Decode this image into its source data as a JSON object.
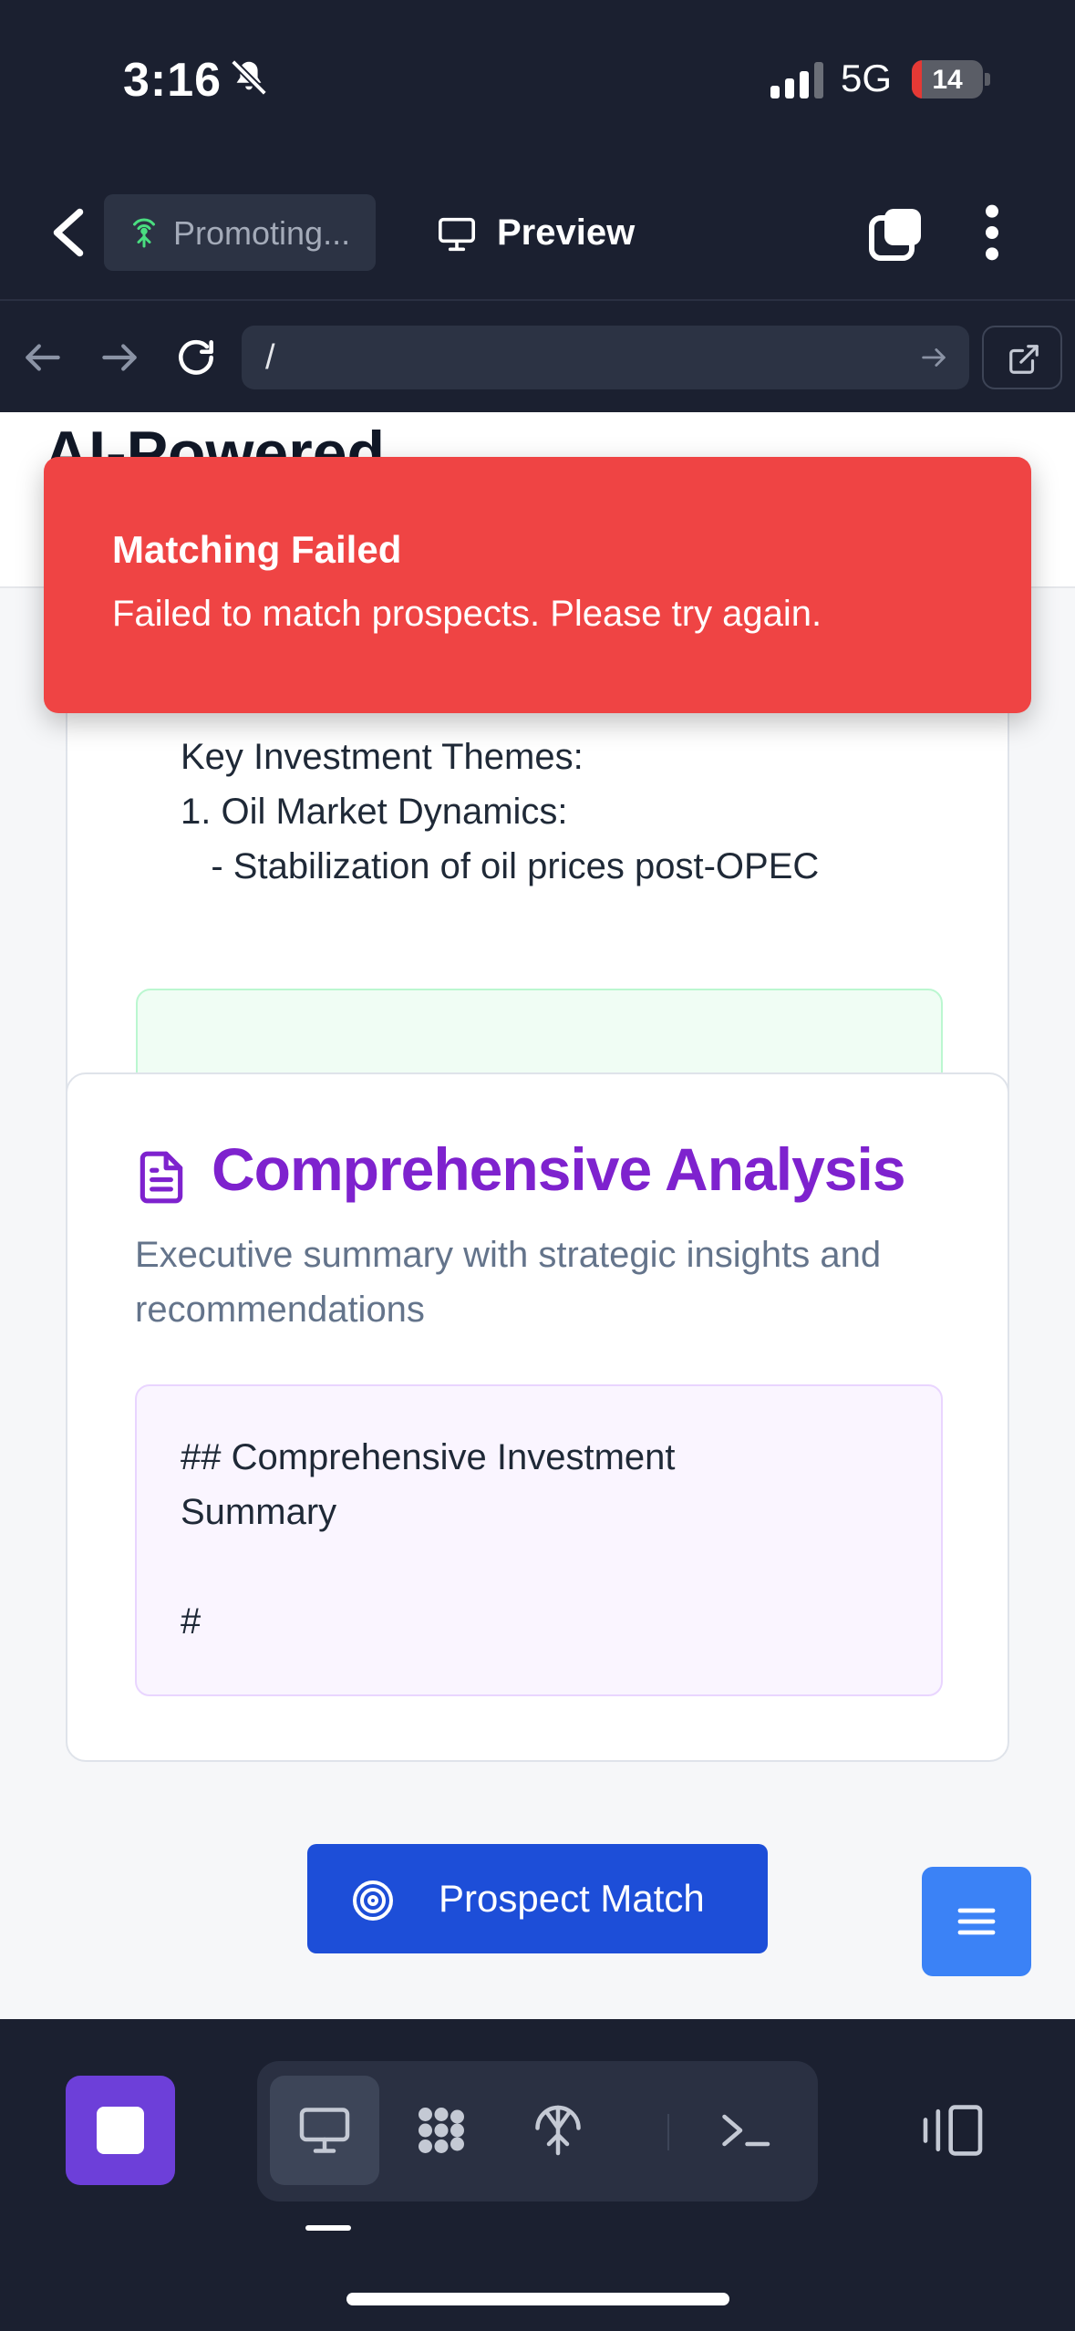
{
  "status_bar": {
    "time": "3:16",
    "network": "5G",
    "battery": "14",
    "battery_level": 0.14
  },
  "app_header": {
    "project_name": "Promoting...",
    "view_tab": "Preview"
  },
  "browser": {
    "url": "/"
  },
  "page": {
    "title": "AI-Powered",
    "card_top": {
      "themes_text": "Key Investment Themes:\n1. Oil Market Dynamics:\n   - Stabilization of oil prices post-OPEC"
    },
    "card_analysis": {
      "title": "Comprehensive Analysis",
      "subtitle": "Executive summary with strategic insights and recommendations",
      "summary_text": "## Comprehensive Investment\nSummary\n\n#"
    },
    "prospect_button": "Prospect Match"
  },
  "toast": {
    "title": "Matching Failed",
    "message": "Failed to match prospects. Please try again."
  },
  "colors": {
    "toast_bg": "#ef4444",
    "accent_purple": "#7e22ce",
    "primary_blue": "#1d4ed8",
    "stop_purple": "#6d3fd9"
  },
  "icons": [
    "back-icon",
    "antenna-icon",
    "monitor-icon",
    "tabs-icon",
    "more-icon",
    "arrow-left-icon",
    "arrow-right-icon",
    "reload-icon",
    "external-link-icon",
    "document-icon",
    "target-icon",
    "menu-icon",
    "stop-icon",
    "dots-grid-icon",
    "terminal-icon",
    "panel-icon"
  ]
}
